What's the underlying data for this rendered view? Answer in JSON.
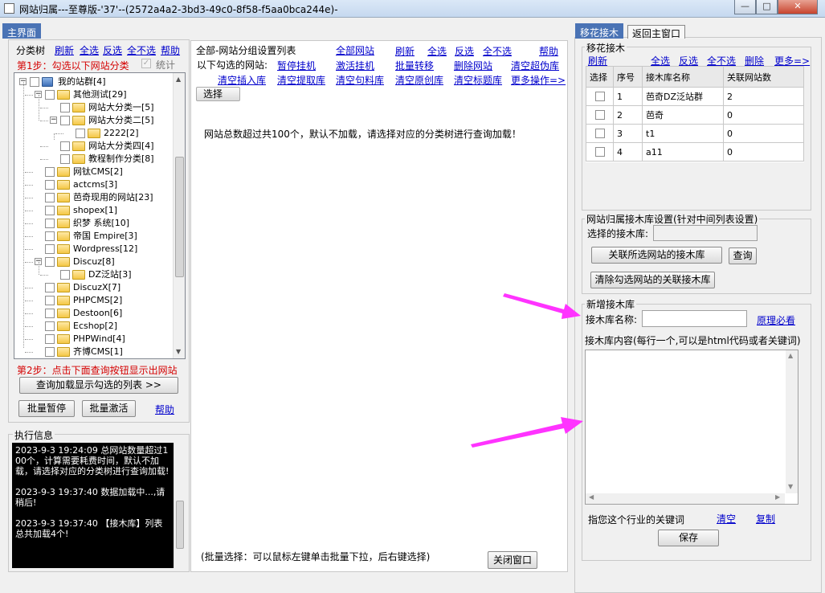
{
  "window": {
    "title": "网站归属---至尊版-'37'--(2572a4a2-3bd3-49c0-8f58-f5aa0bca244e)-",
    "btn_min": "—",
    "btn_max": "□",
    "btn_close": "✕"
  },
  "left_tab": "主界面",
  "tree_panel": {
    "title": "分类树",
    "actions": [
      "刷新",
      "全选",
      "反选",
      "全不选",
      "帮助"
    ],
    "step1": "第1步：勾选以下网站分类",
    "stats": "统计",
    "nodes": [
      {
        "label": "我的站群[4]",
        "level": 0,
        "toggle": "−",
        "icon": "network"
      },
      {
        "label": "其他测试[29]",
        "level": 1,
        "toggle": "−"
      },
      {
        "label": "网站大分类一[5]",
        "level": 2,
        "toggle": ""
      },
      {
        "label": "网站大分类二[5]",
        "level": 2,
        "toggle": "−"
      },
      {
        "label": "2222[2]",
        "level": 3,
        "toggle": ""
      },
      {
        "label": "网站大分类四[4]",
        "level": 2,
        "toggle": ""
      },
      {
        "label": "教程制作分类[8]",
        "level": 2,
        "toggle": ""
      },
      {
        "label": "网钛CMS[2]",
        "level": 1,
        "toggle": ""
      },
      {
        "label": "actcms[3]",
        "level": 1,
        "toggle": ""
      },
      {
        "label": "芭奇现用的网站[23]",
        "level": 1,
        "toggle": ""
      },
      {
        "label": "shopex[1]",
        "level": 1,
        "toggle": ""
      },
      {
        "label": "织梦 系统[10]",
        "level": 1,
        "toggle": ""
      },
      {
        "label": "帝国 Empire[3]",
        "level": 1,
        "toggle": ""
      },
      {
        "label": "Wordpress[12]",
        "level": 1,
        "toggle": ""
      },
      {
        "label": "Discuz[8]",
        "level": 1,
        "toggle": "−"
      },
      {
        "label": "DZ泛站[3]",
        "level": 2,
        "toggle": ""
      },
      {
        "label": "DiscuzX[7]",
        "level": 1,
        "toggle": ""
      },
      {
        "label": "PHPCMS[2]",
        "level": 1,
        "toggle": ""
      },
      {
        "label": "Destoon[6]",
        "level": 1,
        "toggle": ""
      },
      {
        "label": "Ecshop[2]",
        "level": 1,
        "toggle": ""
      },
      {
        "label": "PHPWind[4]",
        "level": 1,
        "toggle": ""
      },
      {
        "label": "齐博CMS[1]",
        "level": 1,
        "toggle": ""
      }
    ],
    "step2": "第2步：点击下面查询按钮显示出网站",
    "query_btn": "查询加载显示勾选的列表 >>",
    "pause_btn": "批量暂停",
    "activate_btn": "批量激活",
    "help": "帮助"
  },
  "exec_panel": {
    "title": "执行信息",
    "logs": [
      "2023-9-3 19:24:09  总网站数量超过100个，计算需要耗费时间，默认不加载，请选择对应的分类树进行查询加载!",
      "2023-9-3 19:37:40  数据加载中...,请稍后!",
      "2023-9-3 19:37:40  【接木库】列表总共加载4个!"
    ]
  },
  "center_panel": {
    "title": "全部-网站分组设置列表",
    "all_sites": "全部网站",
    "actions": [
      "刷新",
      "全选",
      "反选",
      "全不选",
      "帮助"
    ],
    "row2_label": "以下勾选的网站:",
    "row2": [
      "暂停挂机",
      "激活挂机",
      "批量转移",
      "删除网站",
      "清空超伪库"
    ],
    "row3": [
      "清空插入库",
      "清空提取库",
      "清空句料库",
      "清空原创库",
      "清空标题库",
      "更多操作=>"
    ],
    "select_btn": "选择",
    "notice": "网站总数超过共100个，默认不加载，请选择对应的分类树进行查询加载！",
    "footer": "(批量选择：可以鼠标左键单击批量下拉，后右键选择)",
    "close_btn": "关闭窗口"
  },
  "right_tabs": [
    "移花接木",
    "返回主窗口"
  ],
  "graft_panel": {
    "title": "移花接木",
    "actions": [
      "刷新",
      "全选",
      "反选",
      "全不选",
      "删除",
      "更多=>"
    ],
    "columns": [
      "选择",
      "序号",
      "接木库名称",
      "关联网站数"
    ],
    "rows": [
      {
        "no": "1",
        "name": "芭奇DZ泛站群",
        "count": "2"
      },
      {
        "no": "2",
        "name": "芭奇",
        "count": "0"
      },
      {
        "no": "3",
        "name": "t1",
        "count": "0"
      },
      {
        "no": "4",
        "name": "a11",
        "count": "0"
      }
    ]
  },
  "assign_panel": {
    "title": "网站归属接木库设置(针对中间列表设置)",
    "lib_label": "选择的接木库:",
    "lib_value": "",
    "link_btn": "关联所选网站的接木库",
    "query_btn": "查询",
    "clear_btn": "清除勾选网站的关联接木库"
  },
  "new_panel": {
    "title": "新增接木库",
    "name_label": "接木库名称:",
    "name_value": "",
    "principle": "原理必看",
    "content_label": "接木库内容(每行一个,可以是html代码或者关键词)",
    "content_value": "",
    "hint": "指您这个行业的关键词",
    "clear": "清空",
    "copy": "复制",
    "save_btn": "保存"
  },
  "colors": {
    "arrow": "#ff33ff",
    "accent_tab": "#4a73b5",
    "step_red": "#d40000"
  }
}
